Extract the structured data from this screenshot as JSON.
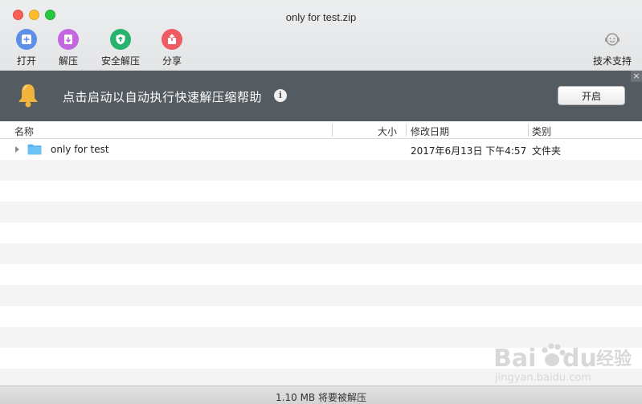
{
  "window": {
    "title": "only for test.zip"
  },
  "toolbar": {
    "items": [
      {
        "label": "打开",
        "icon": "open-icon",
        "color": "#5b8fe8"
      },
      {
        "label": "解压",
        "icon": "extract-icon",
        "color": "#c366e0"
      },
      {
        "label": "安全解压",
        "icon": "shield-icon",
        "color": "#27b36d"
      },
      {
        "label": "分享",
        "icon": "share-icon",
        "color": "#ef5a63"
      }
    ],
    "support_label": "技术支持"
  },
  "banner": {
    "text": "点击启动以自动执行快速解压缩帮助",
    "info_glyph": "i",
    "button_label": "开启",
    "close_glyph": "×"
  },
  "table": {
    "columns": [
      "名称",
      "大小",
      "修改日期",
      "类别"
    ],
    "rows": [
      {
        "name": "only for test",
        "size": "",
        "modified": "2017年6月13日 下午4:57",
        "kind": "文件夹"
      }
    ]
  },
  "status": {
    "text": "1.10 MB 将要被解压"
  },
  "watermark": {
    "brand": "Bai",
    "brand2": "du",
    "cn": "经验",
    "url": "jingyan.baidu.com"
  },
  "colors": {
    "banner_bg": "#545b61",
    "folder": "#58b6f0",
    "toolbar_bg": "#e8eaec"
  }
}
